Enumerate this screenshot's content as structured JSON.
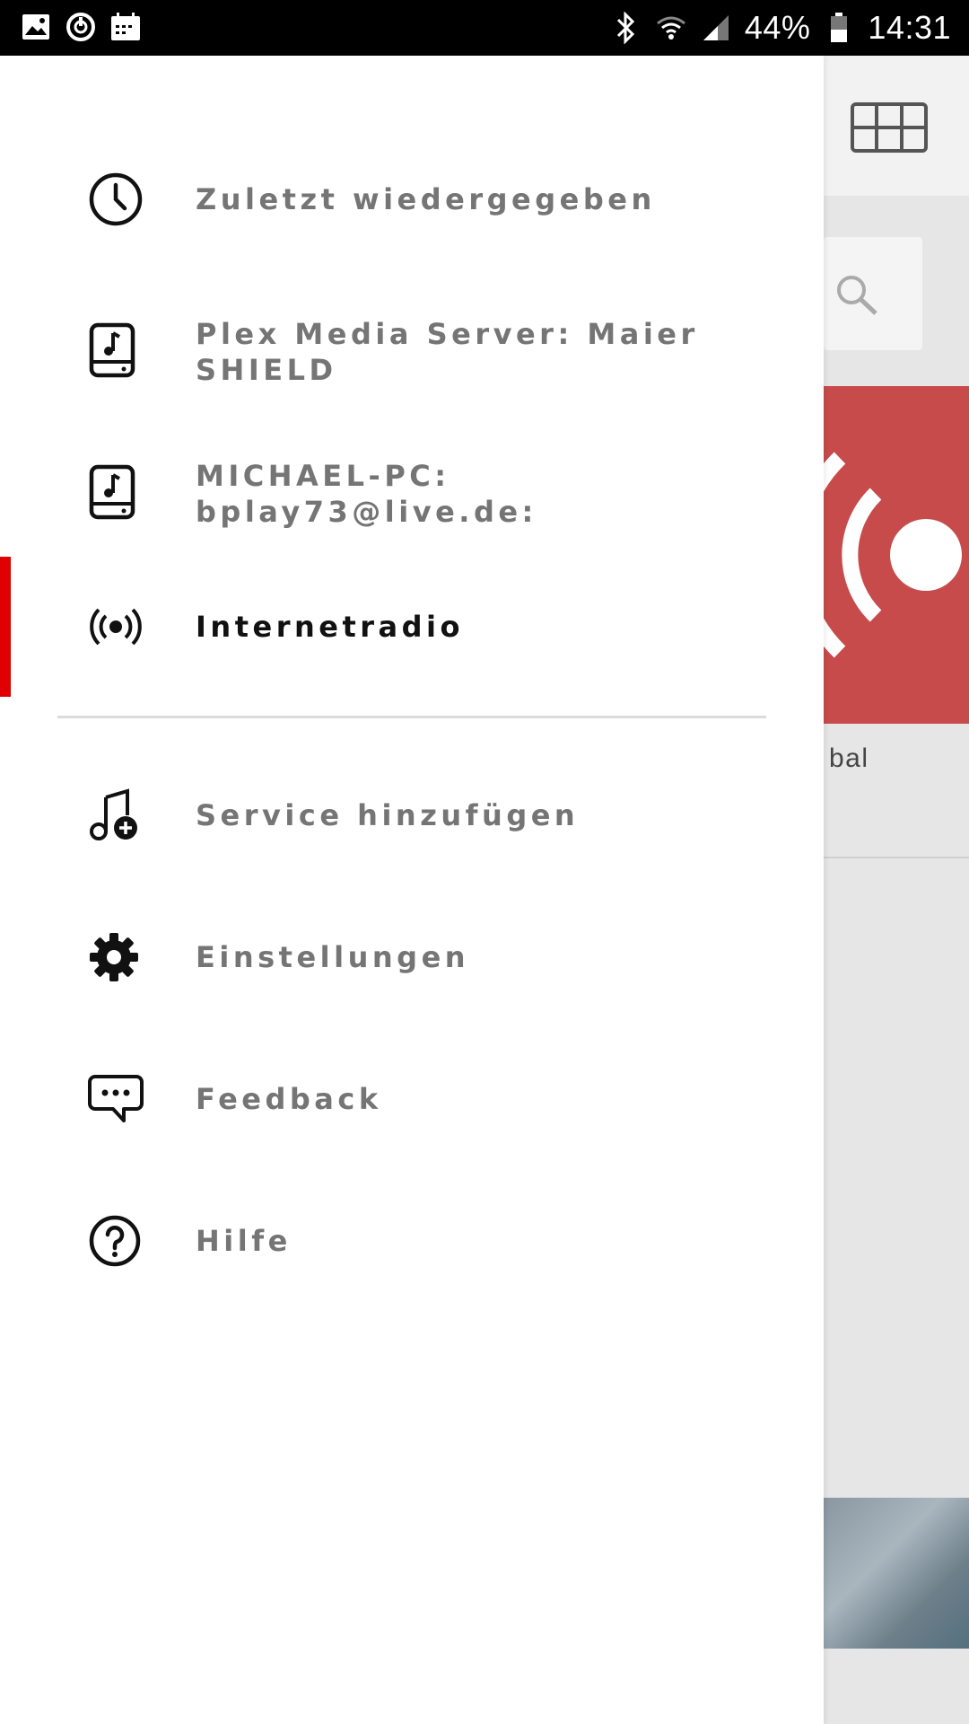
{
  "status_bar": {
    "battery": "44%",
    "time": "14:31",
    "icons": [
      "image-icon",
      "sync-icon",
      "calendar-icon",
      "bluetooth-icon",
      "wifi-icon",
      "signal-icon",
      "battery-icon"
    ]
  },
  "drawer": {
    "items": [
      {
        "label": "Zuletzt wiedergegeben",
        "icon": "clock-icon"
      },
      {
        "label_lines": [
          "Plex Media Server: Maier",
          "SHIELD"
        ],
        "icon": "music-drive-icon"
      },
      {
        "label_lines": [
          "MICHAEL-PC:",
          "bplay73@live.de:"
        ],
        "icon": "music-drive-icon"
      },
      {
        "label": "Internetradio",
        "icon": "radio-broadcast-icon",
        "active": true
      },
      {
        "label": "Service hinzufügen",
        "icon": "music-add-icon"
      },
      {
        "label": "Einstellungen",
        "icon": "gear-icon"
      },
      {
        "label": "Feedback",
        "icon": "chat-bubble-icon"
      },
      {
        "label": "Hilfe",
        "icon": "help-circle-icon"
      }
    ]
  },
  "background": {
    "tile_label": "bal"
  },
  "colors": {
    "active_indicator": "#e00000",
    "label_inactive": "#757575",
    "label_active": "#111111",
    "tile": "#c84b4b"
  }
}
